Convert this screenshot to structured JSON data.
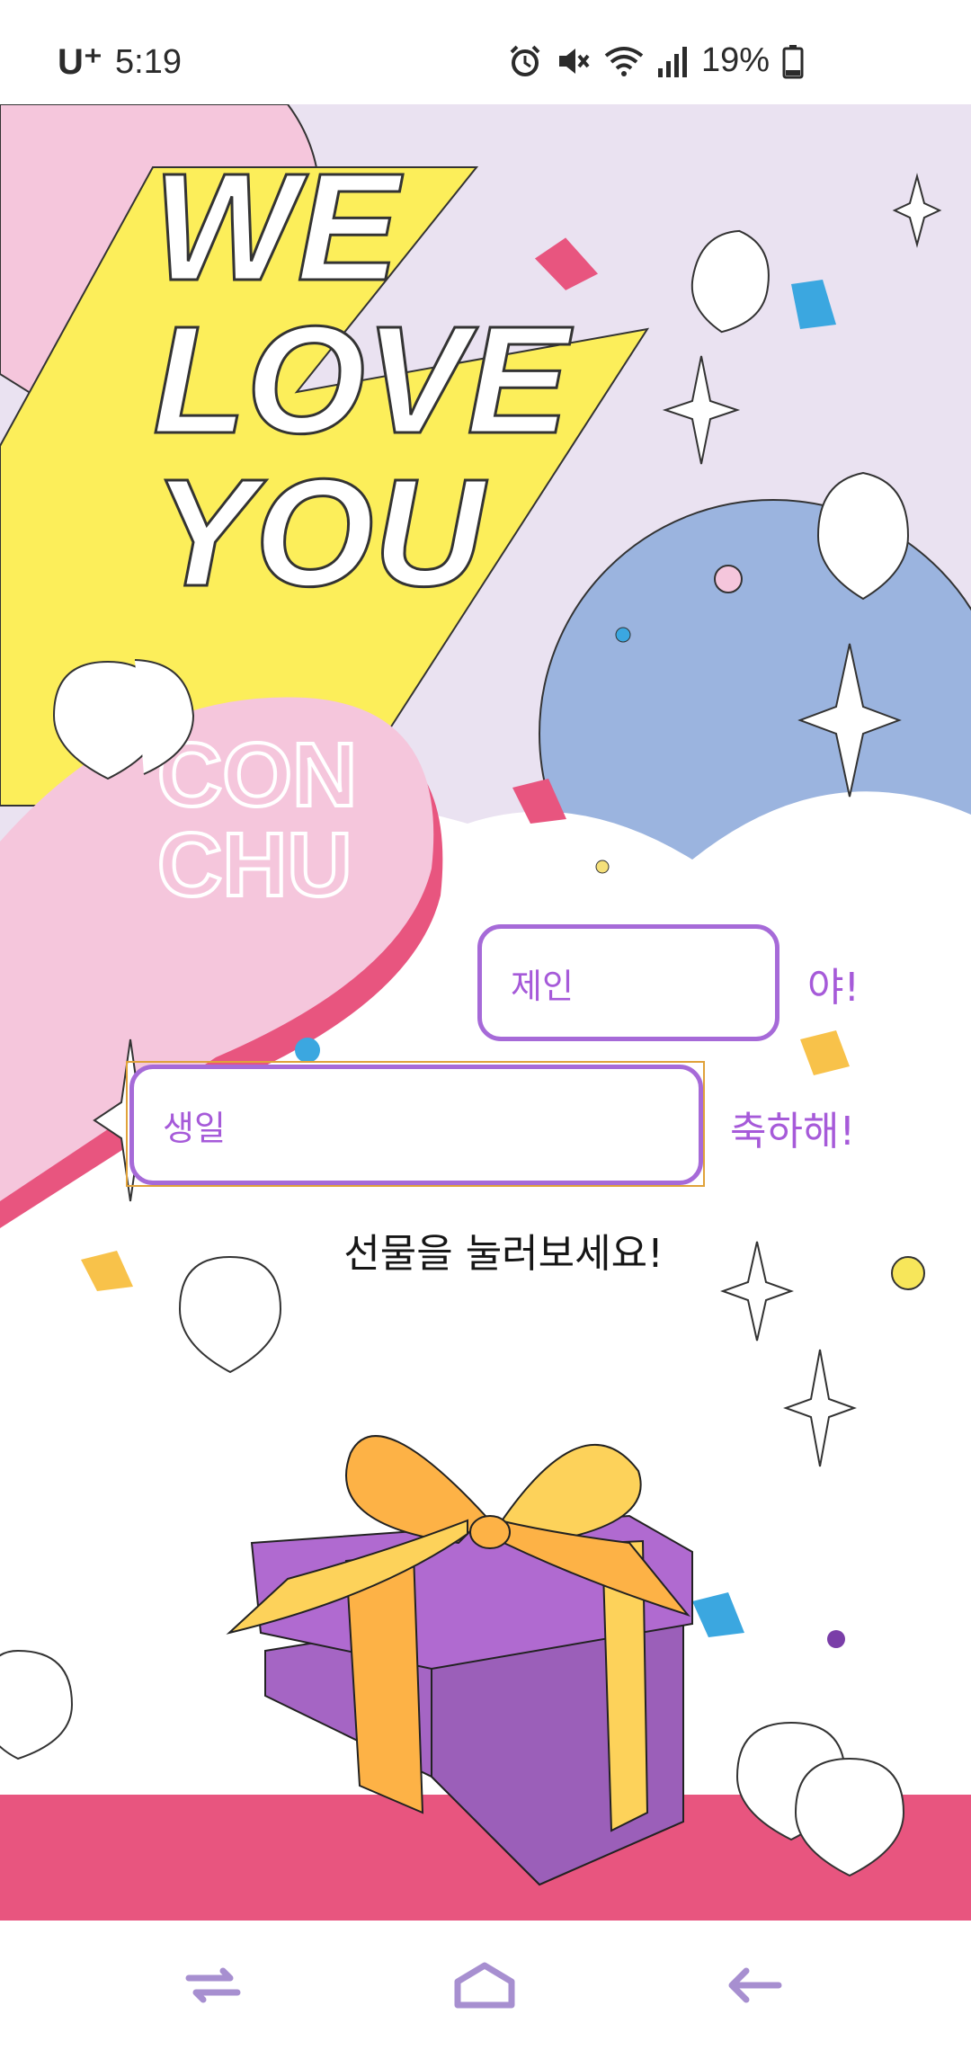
{
  "status_bar": {
    "carrier": "U⁺",
    "time": "5:19",
    "battery": "19%",
    "icons": [
      "alarm-icon",
      "mute-icon",
      "wifi-icon",
      "signal-icon",
      "battery-icon"
    ]
  },
  "hero": {
    "title_lines": [
      "WE",
      "LOVE",
      "YOU"
    ],
    "subtitle_lines": [
      "CON",
      "CHU"
    ]
  },
  "form": {
    "name_value": "제인",
    "name_suffix": "야!",
    "message_value": "생일",
    "message_suffix": "축하해!"
  },
  "prompt": "선물을 눌러보세요!",
  "colors": {
    "accent_purple": "#a65ad9",
    "pink": "#f5c6dc",
    "yellow": "#fcee5a",
    "blue": "#9bb4df",
    "magenta_strip": "#e8557f",
    "gift_purple": "#a565c4",
    "ribbon": "#fdb246"
  },
  "nav": {
    "icons": [
      "recent-apps-icon",
      "home-icon",
      "back-icon"
    ]
  }
}
